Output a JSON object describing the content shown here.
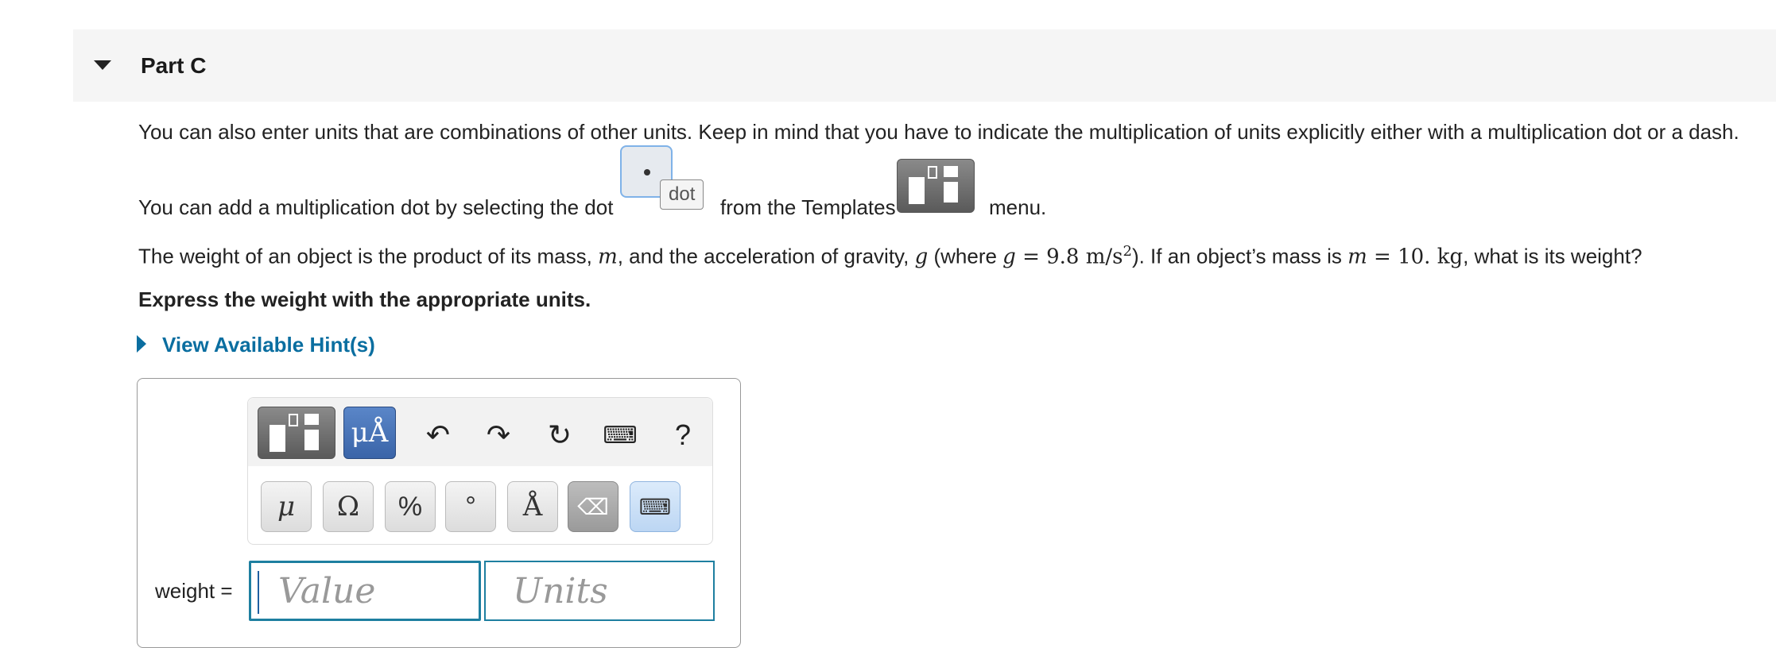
{
  "part": {
    "title": "Part C"
  },
  "intro": {
    "line1": "You can also enter units that are combinations of other units. Keep in mind that you have to indicate the multiplication of units explicitly either with a multiplication dot or a dash.",
    "line2_a": "You can add a multiplication dot by selecting the dot",
    "dot_tooltip": "dot",
    "line2_b": "from the Templates",
    "line2_c": "menu."
  },
  "question": {
    "p1": "The weight of an object is the product of its mass, ",
    "m": "m",
    "p2": ", and the acceleration of gravity, ",
    "g": "g",
    "p3": " (where ",
    "g2": "g",
    "eq1": " = 9.8 m/s",
    "sup": "2",
    "p4": "). If an object’s mass is ",
    "m2": "m",
    "eq2": " = 10. kg",
    "p5": ", what is its weight?",
    "instruction": "Express the weight with the appropriate units."
  },
  "hints": {
    "label": "View Available Hint(s)"
  },
  "toolbar": {
    "units_label": "μÅ",
    "help_label": "?",
    "symbols": [
      "μ",
      "Ω",
      "%",
      "°",
      "Å"
    ]
  },
  "answer": {
    "label": "weight =",
    "value_placeholder": "Value",
    "units_placeholder": "Units"
  }
}
